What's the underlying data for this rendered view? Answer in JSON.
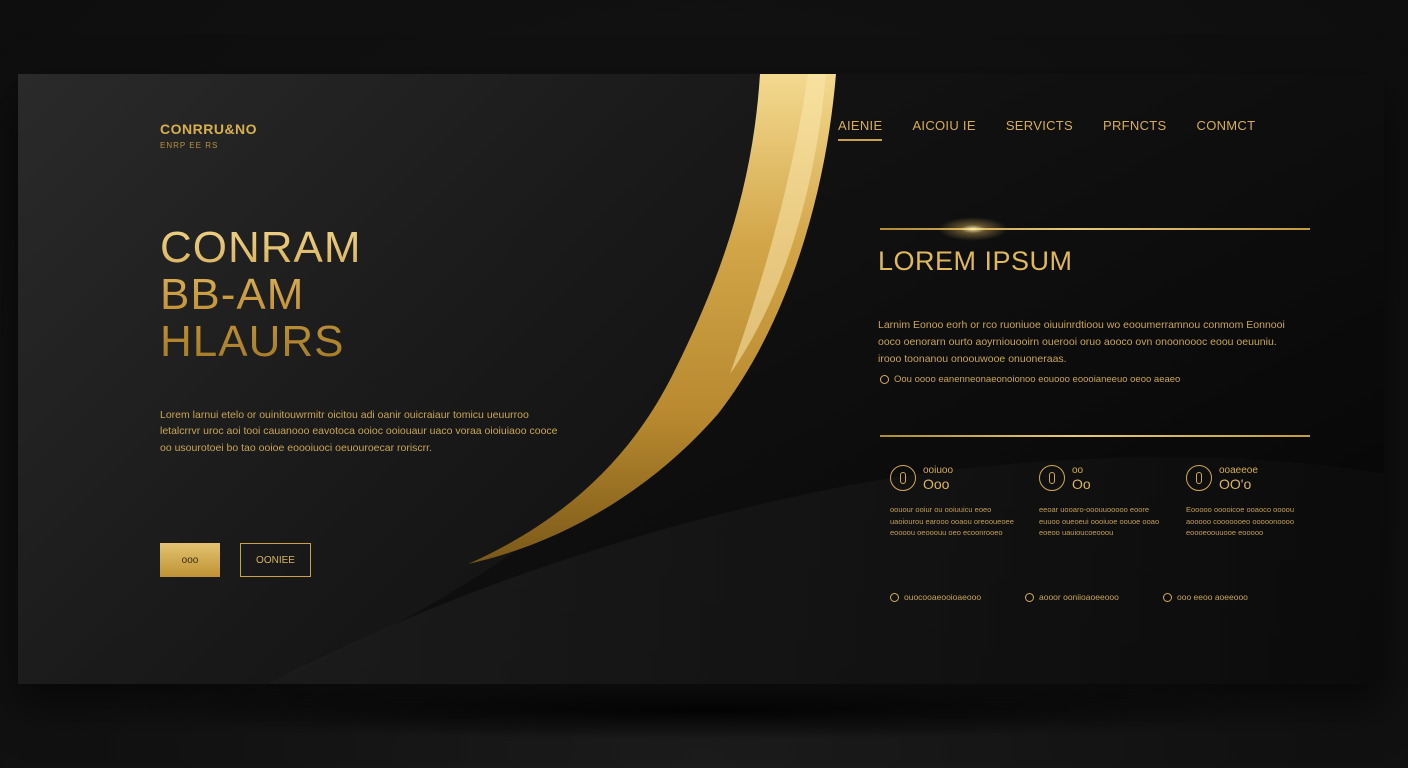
{
  "logo": {
    "name": "CONRRU&NO",
    "tagline": "ENRP EE RS"
  },
  "nav": {
    "items": [
      {
        "label": "AIENIE",
        "active": true
      },
      {
        "label": "AICOIU IE",
        "active": false
      },
      {
        "label": "SERVICTS",
        "active": false
      },
      {
        "label": "PRFNCTS",
        "active": false
      },
      {
        "label": "CONMCT",
        "active": false
      }
    ]
  },
  "hero": {
    "title_lines": [
      "CONRAM",
      "BB-AM",
      "HLAURS"
    ],
    "body": "Lorem larnui etelo or ouinitouwrmitr oicitou adi oanir ouicraiaur tomicu ueuurroo letalcrrvr uroc aoi tooi cauanooo eavotoca ooioc ooiouaur uaco voraa oioiuiaoo cooce oo usourotoei bo tao ooioe eoooiuoci oeuouroecar roriscrr.",
    "primary_button": "ooo",
    "secondary_button": "OONIEE"
  },
  "panel": {
    "title": "LOREM IPSUM",
    "body": "Larnim Eonoo eorh or rco ruoniuoe oiuuinrdtioou wo eooumerramnou conmom Eonnooi ooco oenorarn ourto aoyrniouooirn ouerooi oruo aooco ovn onoonoooc eoou oeuuniu. irooo toonanou onoouwooe onuoneraas.",
    "note": "Oou oooo eanenneonaeonoionoo eouooo eoooianeeuo oeoo aeaeo",
    "features": [
      {
        "label": "ooiuoo",
        "value": "Ooo",
        "text": "oouour ooiur ou ooiuuicu eoeo uaoiourou earooo ooaou oreooueoee eoooou oeooouu oeo ecoonrooeo"
      },
      {
        "label": "oo",
        "value": "Oo",
        "text": "eeoar uooaro-ooouuooooo eoore euuoo oueoeui oooiuoe oouoe ooao eoeoo uauioucoeooou"
      },
      {
        "label": "ooaeeoe",
        "value": "OO'o",
        "text": "Eooooo ooooicoe ooaoco oooou aooooo cooooooeo ooooonoooo eoooeoouuooe eooooo"
      }
    ],
    "footer": [
      {
        "label": "ouocooaeooioaeooo"
      },
      {
        "label": "aooor ooniioaoeeooo"
      },
      {
        "label": "ooo eeoo aoeeooo"
      }
    ]
  },
  "colors": {
    "gold": "#d6ae55",
    "gold_light": "#f0d48a",
    "gold_dark": "#a47a28",
    "background": "#141414"
  },
  "icons": {
    "feature": "info-ring-icon",
    "note": "circle-dot-icon"
  }
}
